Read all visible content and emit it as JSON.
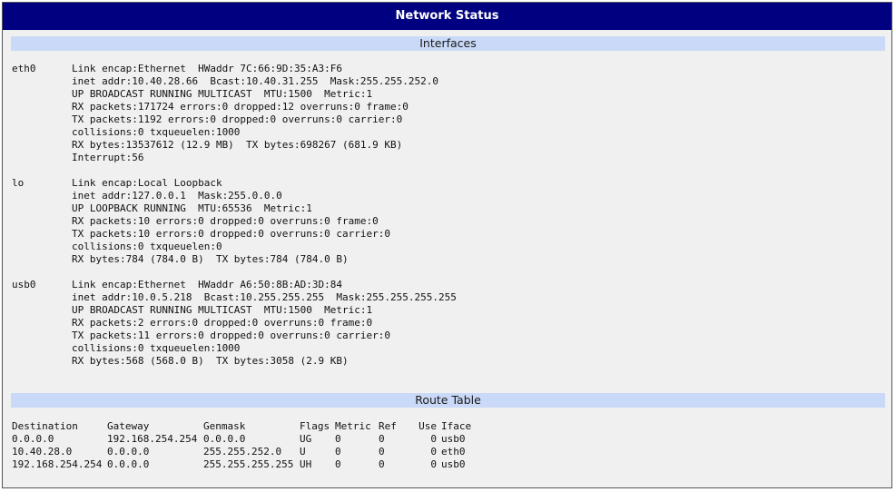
{
  "window": {
    "title": "Network Status"
  },
  "sections": {
    "interfaces": "Interfaces",
    "route_table": "Route Table"
  },
  "interfaces": [
    {
      "name": "eth0",
      "lines": [
        "Link encap:Ethernet  HWaddr 7C:66:9D:35:A3:F6",
        "inet addr:10.40.28.66  Bcast:10.40.31.255  Mask:255.255.252.0",
        "UP BROADCAST RUNNING MULTICAST  MTU:1500  Metric:1",
        "RX packets:171724 errors:0 dropped:12 overruns:0 frame:0",
        "TX packets:1192 errors:0 dropped:0 overruns:0 carrier:0",
        "collisions:0 txqueuelen:1000",
        "RX bytes:13537612 (12.9 MB)  TX bytes:698267 (681.9 KB)",
        "Interrupt:56"
      ]
    },
    {
      "name": "lo",
      "lines": [
        "Link encap:Local Loopback",
        "inet addr:127.0.0.1  Mask:255.0.0.0",
        "UP LOOPBACK RUNNING  MTU:65536  Metric:1",
        "RX packets:10 errors:0 dropped:0 overruns:0 frame:0",
        "TX packets:10 errors:0 dropped:0 overruns:0 carrier:0",
        "collisions:0 txqueuelen:0",
        "RX bytes:784 (784.0 B)  TX bytes:784 (784.0 B)"
      ]
    },
    {
      "name": "usb0",
      "lines": [
        "Link encap:Ethernet  HWaddr A6:50:8B:AD:3D:84",
        "inet addr:10.0.5.218  Bcast:10.255.255.255  Mask:255.255.255.255",
        "UP BROADCAST RUNNING MULTICAST  MTU:1500  Metric:1",
        "RX packets:2 errors:0 dropped:0 overruns:0 frame:0",
        "TX packets:11 errors:0 dropped:0 overruns:0 carrier:0",
        "collisions:0 txqueuelen:1000",
        "RX bytes:568 (568.0 B)  TX bytes:3058 (2.9 KB)"
      ]
    }
  ],
  "route_table": {
    "headers": [
      "Destination",
      "Gateway",
      "Genmask",
      "Flags",
      "Metric",
      "Ref",
      "Use",
      "Iface"
    ],
    "rows": [
      [
        "0.0.0.0",
        "192.168.254.254",
        "0.0.0.0",
        "UG",
        "0",
        "0",
        "0",
        "usb0"
      ],
      [
        "10.40.28.0",
        "0.0.0.0",
        "255.255.252.0",
        "U",
        "0",
        "0",
        "0",
        "eth0"
      ],
      [
        "192.168.254.254",
        "0.0.0.0",
        "255.255.255.255",
        "UH",
        "0",
        "0",
        "0",
        "usb0"
      ]
    ]
  }
}
